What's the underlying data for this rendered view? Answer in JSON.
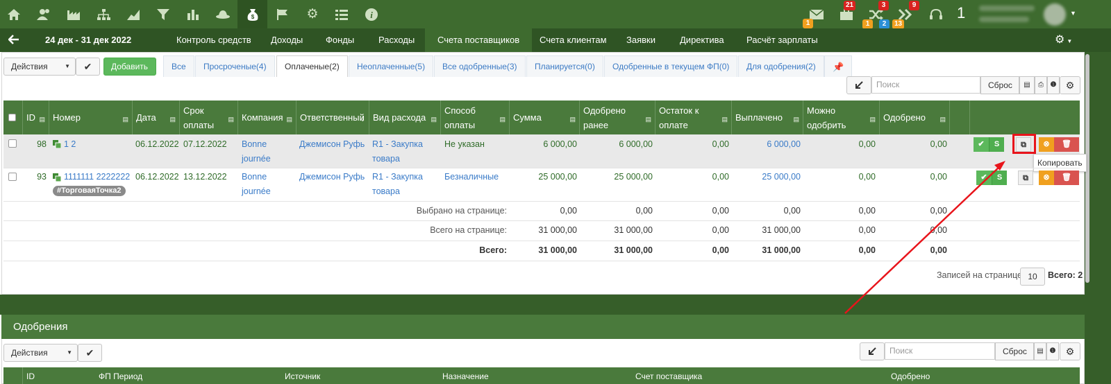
{
  "topbar": {
    "icons": [
      "home-icon",
      "users-icon",
      "factory-icon",
      "hierarchy-icon",
      "growth-chart-icon",
      "filter-icon",
      "bar-chart-icon",
      "hat-icon",
      "money-bag-icon",
      "flag-icon",
      "gear-icon",
      "list-icon",
      "info-icon"
    ],
    "notifications": {
      "mail_badge": "1",
      "tasks_badge_top": "21",
      "tasks_badge_bottom": "1",
      "shuffle_badge_top": "3",
      "shuffle_badge_left": "1",
      "shuffle_badge_right": "2",
      "forward_badge_top": "9",
      "forward_badge_bottom": "13",
      "count": "1"
    }
  },
  "nav": {
    "date_range": "24 дек - 31 дек 2022",
    "items": [
      "Контроль средств",
      "Доходы",
      "Фонды",
      "Расходы",
      "Счета поставщиков",
      "Счета клиентам",
      "Заявки",
      "Директива",
      "Расчёт зарплаты"
    ],
    "active": "Счета поставщиков"
  },
  "toolbar": {
    "actions_label": "Действия",
    "add_label": "Добавить",
    "search_placeholder": "Поиск",
    "reset_label": "Сброс"
  },
  "tabs": [
    "Все",
    "Просроченые(4)",
    "Оплаченые(2)",
    "Неоплаченные(5)",
    "Все одобренные(3)",
    "Планируется(0)",
    "Одобренные в текущем ФП(0)",
    "Для одобрения(2)"
  ],
  "columns": [
    "ID",
    "Номер",
    "Дата",
    "Срок оплаты",
    "Компания",
    "Ответственный",
    "Вид расхода",
    "Способ оплаты",
    "Сумма",
    "Одобрено ранее",
    "Остаток к оплате",
    "Выплачено",
    "Можно одобрить",
    "Одобрено"
  ],
  "rows": [
    {
      "id": "98",
      "number": "1 2",
      "date": "06.12.2022",
      "due": "07.12.2022",
      "company": "Bonne journée",
      "responsible": "Джемисон Руфь",
      "expense_type": "R1 - Закупка товара",
      "payment": "Не указан",
      "sum": "6 000,00",
      "approved_before": "6 000,00",
      "remaining": "0,00",
      "paid": "6 000,00",
      "can_approve": "0,00",
      "approved": "0,00",
      "tag": ""
    },
    {
      "id": "93",
      "number": "1111111 2222222",
      "date": "06.12.2022",
      "due": "13.12.2022",
      "company": "Bonne journée",
      "responsible": "Джемисон Руфь",
      "expense_type": "R1 - Закупка товара",
      "payment": "Безналичные",
      "sum": "25 000,00",
      "approved_before": "25 000,00",
      "remaining": "0,00",
      "paid": "25 000,00",
      "can_approve": "0,00",
      "approved": "0,00",
      "tag": "#ТорговаяТочка2"
    }
  ],
  "tooltip": "Копировать",
  "summary": [
    {
      "label": "Выбрано на странице:",
      "sum": "0,00",
      "approved_before": "0,00",
      "remaining": "0,00",
      "paid": "0,00",
      "can_approve": "0,00",
      "approved": "0,00",
      "bold": false
    },
    {
      "label": "Всего на странице:",
      "sum": "31 000,00",
      "approved_before": "31 000,00",
      "remaining": "0,00",
      "paid": "31 000,00",
      "can_approve": "0,00",
      "approved": "0,00",
      "bold": false
    },
    {
      "label": "Всего:",
      "sum": "31 000,00",
      "approved_before": "31 000,00",
      "remaining": "0,00",
      "paid": "31 000,00",
      "can_approve": "0,00",
      "approved": "0,00",
      "bold": true
    }
  ],
  "pager": {
    "label": "Записей на странице",
    "per_page": "10",
    "total_label": "Всего: 2"
  },
  "approvals": {
    "title": "Одобрения",
    "actions_label": "Действия",
    "search_placeholder": "Поиск",
    "reset_label": "Сброс",
    "columns": [
      "ID",
      "ФП Период",
      "Источник",
      "Назначение",
      "Счет поставщика",
      "Одобрено"
    ]
  },
  "colors": {
    "topbar": "#3e6b2f",
    "nav": "#2f5424",
    "header": "#4a7a3c",
    "link": "#3a7bc8",
    "value": "#2f6b28",
    "annotation": "#e8141b"
  }
}
